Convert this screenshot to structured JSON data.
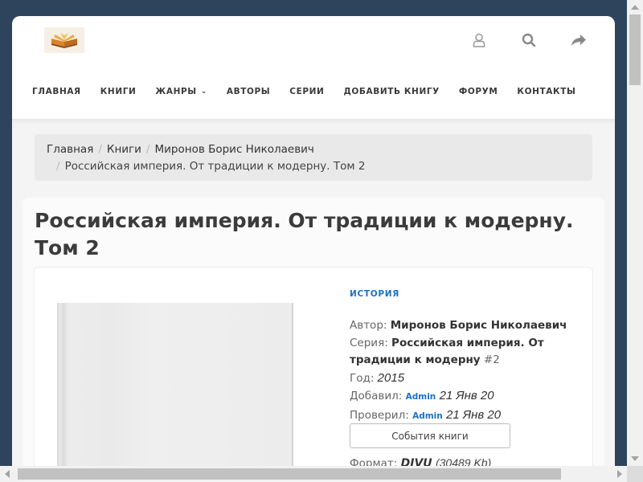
{
  "header": {
    "logo": "open-book-logo",
    "icons": [
      "user-icon",
      "search-icon",
      "share-icon"
    ]
  },
  "nav": {
    "items": [
      {
        "label": "Главная"
      },
      {
        "label": "Книги"
      },
      {
        "label": "Жанры",
        "has_dropdown": true
      },
      {
        "label": "Авторы"
      },
      {
        "label": "Серии"
      },
      {
        "label": "Добавить книгу"
      },
      {
        "label": "Форум"
      },
      {
        "label": "Контакты"
      }
    ]
  },
  "breadcrumb": {
    "items": [
      "Главная",
      "Книги",
      "Миронов Борис Николаевич",
      "Российская империя. От традиции к модерну. Том 2"
    ]
  },
  "book": {
    "title": "Российская империя. От традиции к модерну. Том 2",
    "genre": "ИСТОРИЯ",
    "author_label": "Автор:",
    "author": "Миронов Борис Николаевич",
    "series_label": "Серия:",
    "series": "Российская империя. От традиции к модерну",
    "series_number": "#2",
    "year_label": "Год:",
    "year": "2015",
    "added_label": "Добавил:",
    "added_by": "Admin",
    "added_date": "21 Янв 20",
    "checked_label": "Проверил:",
    "checked_by": "Admin",
    "checked_date": "21 Янв 20",
    "events_button": "События книги",
    "format_label": "Формат:",
    "format": "DJVU",
    "size": "(30489 Kb)"
  },
  "colors": {
    "background": "#2e445c",
    "accent": "#1a72c9"
  }
}
